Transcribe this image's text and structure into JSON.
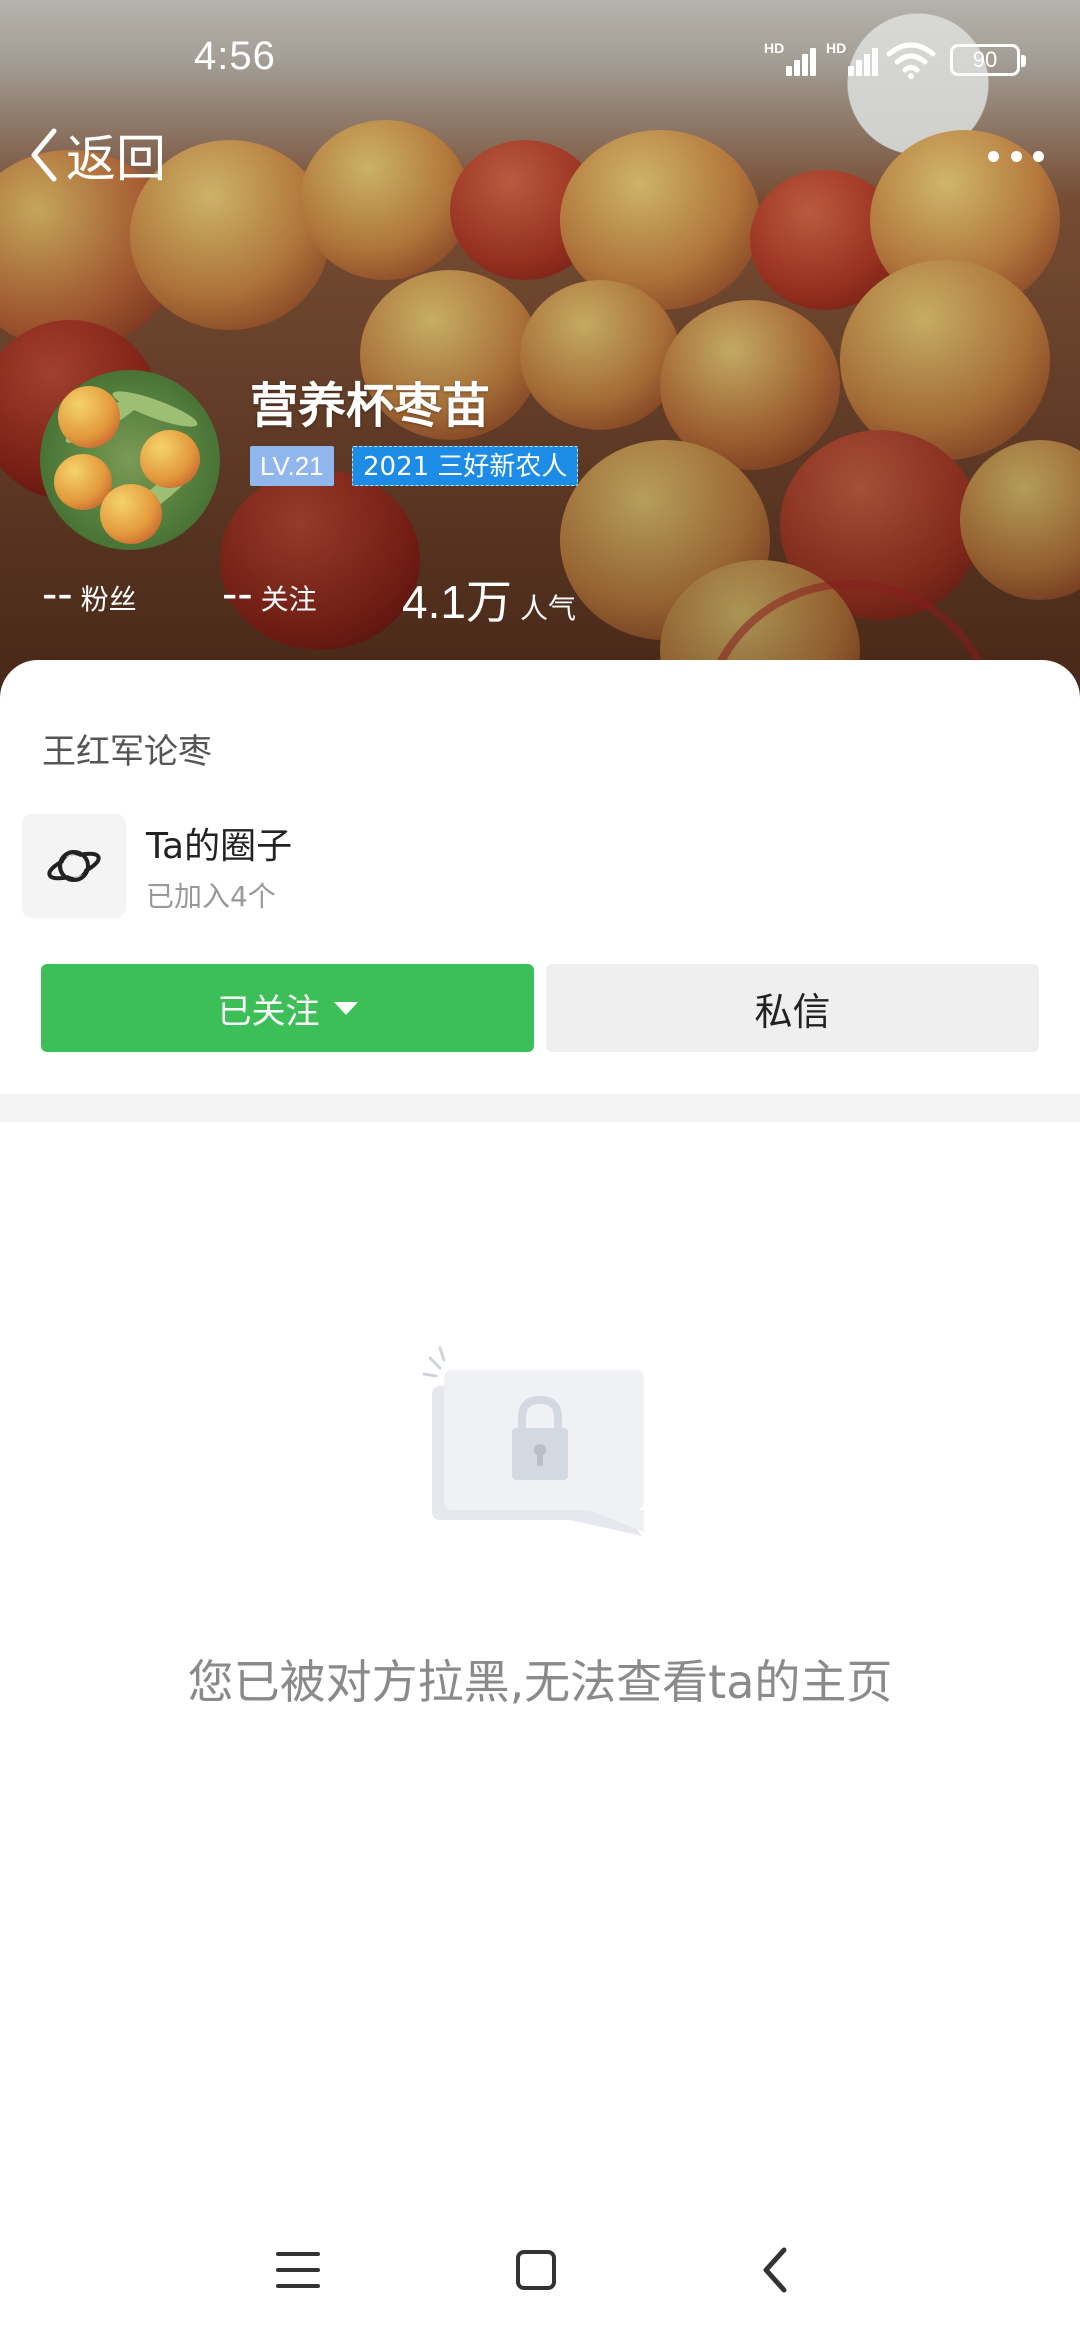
{
  "status_bar": {
    "time": "4:56",
    "signal_1_label": "HD",
    "signal_2_label": "HD",
    "battery": "90"
  },
  "nav": {
    "back_label": "返回"
  },
  "profile": {
    "name": "营养杯枣苗",
    "level": "LV.21",
    "honor": "2021 三好新农人",
    "stats": {
      "fans_value": "--",
      "fans_label": "粉丝",
      "following_value": "--",
      "following_label": "关注",
      "popularity_value": "4.1万",
      "popularity_label": "人气"
    }
  },
  "bio": "王红军论枣",
  "circle": {
    "title": "Ta的圈子",
    "subtitle": "已加入4个"
  },
  "actions": {
    "followed_label": "已关注",
    "message_label": "私信"
  },
  "blocked": {
    "message": "您已被对方拉黑,无法查看ta的主页"
  },
  "colors": {
    "follow_green": "#3cbf57",
    "level_blue": "#8fb7ee",
    "honor_blue": "#1c8ce6"
  }
}
